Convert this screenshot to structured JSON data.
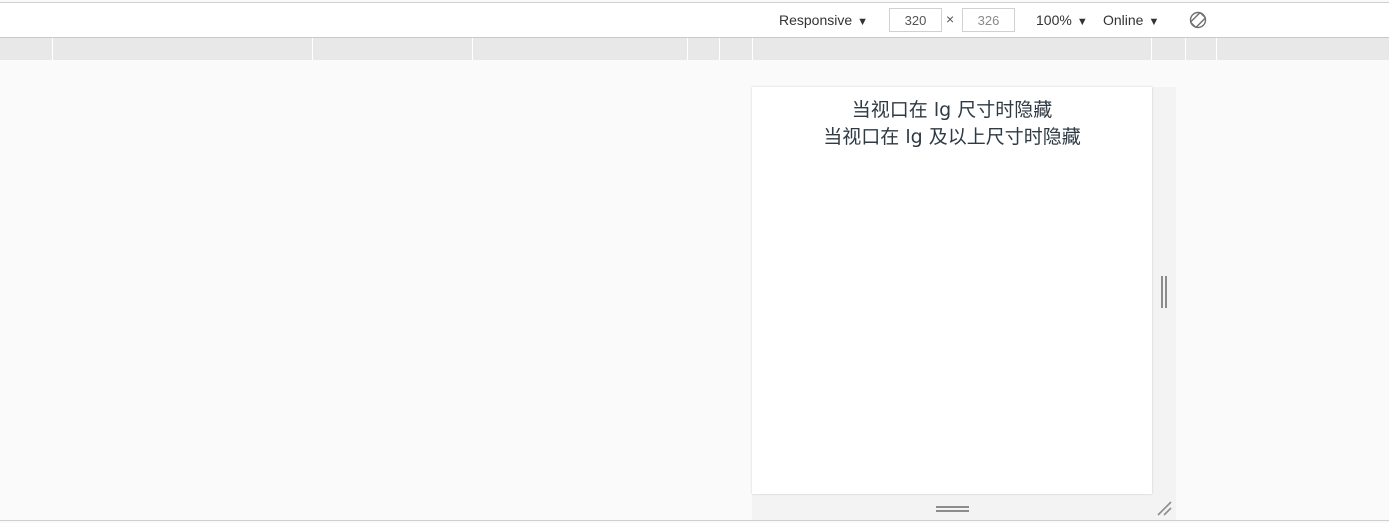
{
  "toolbar": {
    "device_label": "Responsive",
    "width_value": "320",
    "times_symbol": "×",
    "height_value": "326",
    "zoom_label": "100%",
    "throttle_label": "Online",
    "caret": "▼"
  },
  "device_content": {
    "line1": "当视口在 lg 尺寸时隐藏",
    "line2": "当视口在 lg 及以上尺寸时隐藏"
  },
  "icons": {
    "rotate": "rotate-icon",
    "right_resize": "resize-handle-icon",
    "bottom_resize": "resize-handle-icon",
    "corner_resize": "resize-corner-icon"
  },
  "colors": {
    "toolbar_bg": "#ffffff",
    "ruler_bg": "#e8e8e8",
    "canvas_bg": "#fafafa",
    "device_bg": "#ffffff",
    "device_text": "#2e3a44"
  }
}
